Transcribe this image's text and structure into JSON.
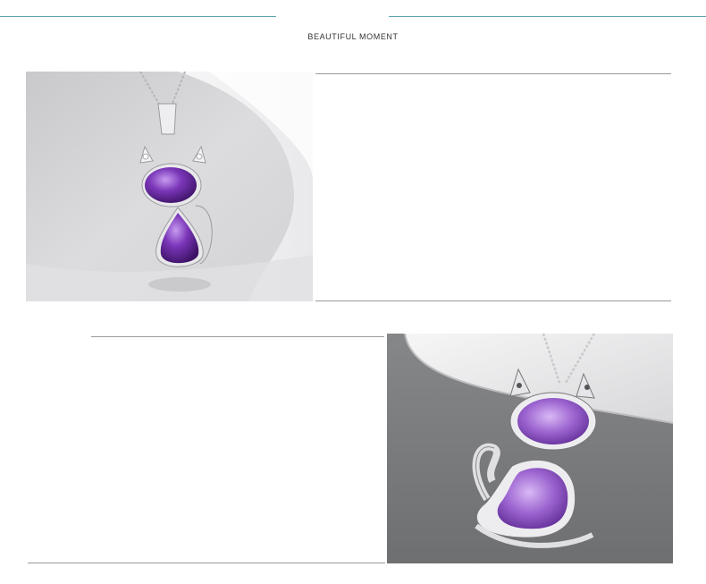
{
  "header": {
    "title": "BEAUTIFUL MOMENT"
  },
  "colors": {
    "accent_line": "#5fa3a9",
    "rule": "#9a9a9a",
    "amethyst": "#6b2fa0",
    "silver": "#e6e6ea"
  },
  "photos": [
    {
      "subject": "cat-pendant-front"
    },
    {
      "subject": "cat-pendant-back"
    }
  ]
}
